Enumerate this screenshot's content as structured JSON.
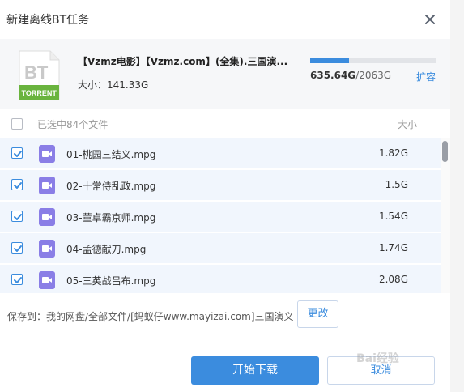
{
  "dialog": {
    "title": "新建离线BT任务"
  },
  "torrent": {
    "icon_top": "BT",
    "icon_bottom": "TORRENT",
    "name": "【Vzmz电影】【Vzmz.com】(全集).三国演...",
    "size_label": "大小：141.33G",
    "space_used": "635.64G",
    "space_total": "/2063G",
    "space_fraction": 0.308,
    "expand_label": "扩容"
  },
  "list_header": {
    "selected_label": "已选中84个文件",
    "size_label": "大小"
  },
  "files": [
    {
      "name": "01-桃园三结义.mpg",
      "size": "1.82G"
    },
    {
      "name": "02-十常侍乱政.mpg",
      "size": "1.5G"
    },
    {
      "name": "03-董卓霸京师.mpg",
      "size": "1.54G"
    },
    {
      "name": "04-孟德献刀.mpg",
      "size": "1.74G"
    },
    {
      "name": "05-三英战吕布.mpg",
      "size": "2.08G"
    }
  ],
  "save": {
    "path_label": "保存到：我的网盘/全部文件/[蚂蚁仔www.mayizai.com]三国演义",
    "change_label": "更改"
  },
  "actions": {
    "start_label": "开始下载",
    "cancel_label": "取消"
  },
  "colors": {
    "accent": "#3b8cde",
    "row_bg": "#f1f6fd",
    "video_icon": "#8a7ee6",
    "torrent_green": "#6ab43e"
  }
}
